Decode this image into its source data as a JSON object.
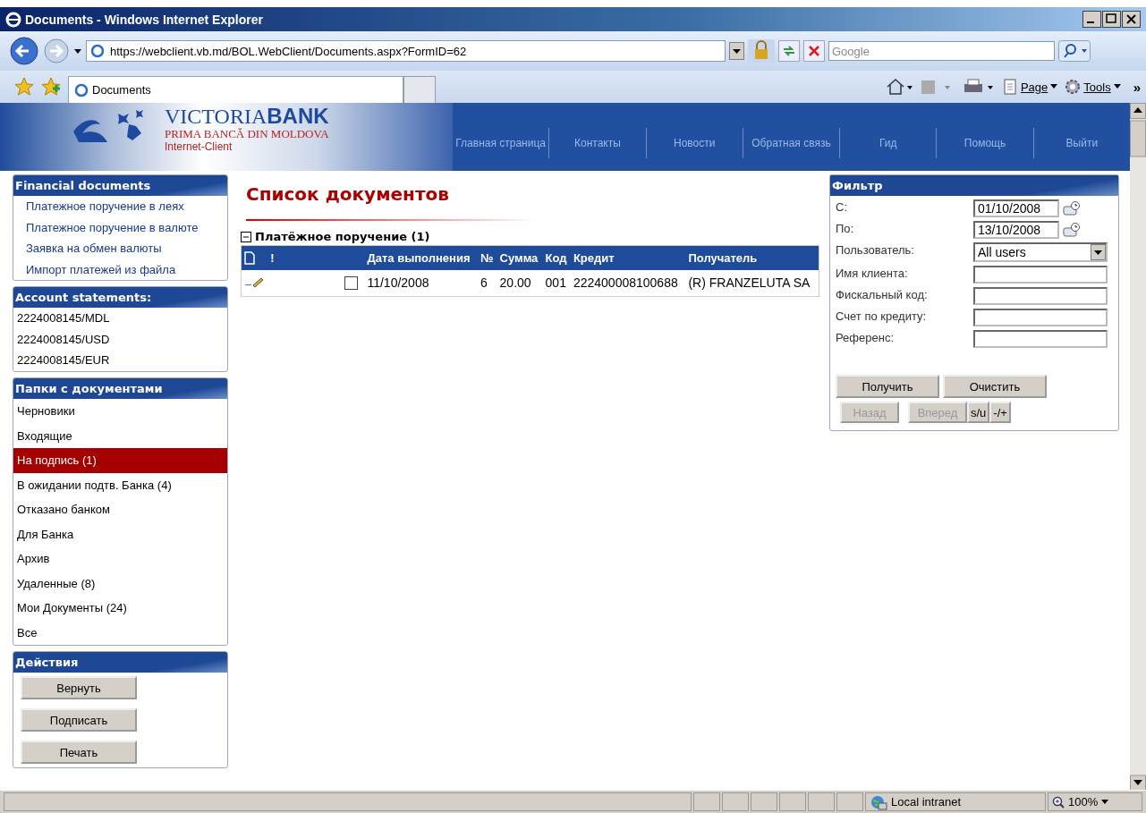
{
  "window": {
    "title": "Documents - Windows Internet Explorer"
  },
  "toolbar": {
    "address": "https://webclient.vb.md/BOL.WebClient/Documents.aspx?FormID=62",
    "search_placeholder": "Google"
  },
  "tabs": [
    {
      "label": "Documents",
      "selected": true
    }
  ],
  "commands": [
    {
      "label": "Page"
    },
    {
      "label": "Tools"
    }
  ],
  "chevron": "»",
  "header": {
    "logo": "VICTORIA**BANK**",
    "tagline": "PRIMA BANCĂ DIN MOLDOVA",
    "product": "Internet-Client",
    "nav": [
      "Главная страница",
      "Контакты",
      "Новости",
      "Обратная связь",
      "Гид",
      "Помощь",
      "Выйти"
    ]
  },
  "sidebar": {
    "panels": [
      {
        "title": "Financial documents",
        "kind": "links",
        "items": [
          {
            "label": "Платежное поручение в леях",
            "selected": false
          },
          {
            "label": "Платежное поручение в валюте",
            "selected": false
          },
          {
            "label": "Заявка на обмен валюты",
            "selected": false
          },
          {
            "label": "Импорт платежей из файла",
            "selected": false
          }
        ]
      },
      {
        "title": "Account statements:",
        "kind": "accounts",
        "items": [
          {
            "label": "2224008145/MDL",
            "selected": false
          },
          {
            "label": "2224008145/USD",
            "selected": false
          },
          {
            "label": "2224008145/EUR",
            "selected": false
          }
        ]
      },
      {
        "title": "Папки с документами",
        "kind": "folders",
        "items": [
          {
            "label": "Черновики",
            "selected": false
          },
          {
            "label": "Входящие",
            "selected": false
          },
          {
            "label": "На подпись (1)",
            "selected": true
          },
          {
            "label": "В ожидании подтв. Банка (4)",
            "selected": false
          },
          {
            "label": "Отказано банком",
            "selected": false
          },
          {
            "label": "Для Банка",
            "selected": false
          },
          {
            "label": "Архив",
            "selected": false
          },
          {
            "label": "Удаленные (8)",
            "selected": false
          },
          {
            "label": "Мои Документы (24)",
            "selected": false
          },
          {
            "label": "Все",
            "selected": false
          }
        ]
      },
      {
        "title": "Действия",
        "kind": "buttons",
        "items": [
          {
            "label": "Вернуть",
            "selected": false
          },
          {
            "label": "Подписать",
            "selected": false
          },
          {
            "label": "Печать",
            "selected": false
          }
        ]
      }
    ]
  },
  "main": {
    "title": "Список документов",
    "group": {
      "label": "Платёжное поручение (1)",
      "expanded": true
    },
    "table": {
      "columns": [
        {
          "kind": "doc"
        },
        {
          "kind": "text",
          "label": "!"
        },
        {
          "kind": "blank"
        },
        {
          "kind": "text",
          "label": "Дата выполнения"
        },
        {
          "kind": "text",
          "label": "№"
        },
        {
          "kind": "text",
          "label": "Сумма"
        },
        {
          "kind": "text",
          "label": "Код"
        },
        {
          "kind": "text",
          "label": "Кредит"
        },
        {
          "kind": "text",
          "label": "Получатель"
        }
      ],
      "rows": [
        {
          "checked": false,
          "cells": [
            "",
            "",
            "",
            "11/10/2008",
            "6",
            "20.00",
            "001",
            "222400008100688",
            "(R) FRANZELUTA SA"
          ]
        }
      ]
    }
  },
  "filter": {
    "title": "Фильтр",
    "fields": [
      {
        "label": "С:",
        "kind": "date",
        "value": "01/10/2008"
      },
      {
        "label": "По:",
        "kind": "date",
        "value": "13/10/2008"
      },
      {
        "label": "Пользователь:",
        "kind": "select",
        "value": "All users"
      },
      {
        "label": "Имя клиента:",
        "kind": "text"
      },
      {
        "label": "Фискальный код:",
        "kind": "text"
      },
      {
        "label": "Счет по кредиту:",
        "kind": "text"
      },
      {
        "label": "Референс:",
        "kind": "text"
      }
    ],
    "buttons": [
      {
        "label": "Получить",
        "disabled": false
      },
      {
        "label": "Очистить",
        "disabled": false
      }
    ],
    "nav_buttons": [
      {
        "label": "Назад",
        "disabled": true
      },
      {
        "label": "Вперед",
        "disabled": true
      },
      {
        "label": "s/u",
        "disabled": false
      },
      {
        "label": "-/+",
        "disabled": false
      }
    ]
  },
  "status_bar": {
    "zone": "Local intranet",
    "zoom": "100%"
  }
}
